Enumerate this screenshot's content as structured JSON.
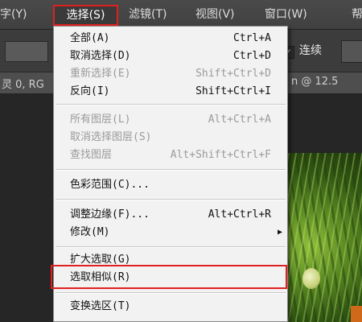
{
  "menubar": {
    "type": "字(Y)",
    "select": "选择(S)",
    "filter": "滤镜(T)",
    "view": "视图(V)",
    "window": "窗口(W)",
    "help": "帮"
  },
  "options_bar": {
    "contiguous_label": "连续",
    "contiguous_checked": true
  },
  "doc_tab": {
    "left_text": "灵 0, RG",
    "right_text": "n @ 12.5"
  },
  "select_menu": {
    "items": [
      {
        "label": "全部(A)",
        "shortcut": "Ctrl+A",
        "enabled": true
      },
      {
        "label": "取消选择(D)",
        "shortcut": "Ctrl+D",
        "enabled": true
      },
      {
        "label": "重新选择(E)",
        "shortcut": "Shift+Ctrl+D",
        "enabled": false
      },
      {
        "label": "反向(I)",
        "shortcut": "Shift+Ctrl+I",
        "enabled": true
      },
      {
        "label": "所有图层(L)",
        "shortcut": "Alt+Ctrl+A",
        "enabled": false
      },
      {
        "label": "取消选择图层(S)",
        "shortcut": "",
        "enabled": false
      },
      {
        "label": "查找图层",
        "shortcut": "Alt+Shift+Ctrl+F",
        "enabled": false
      },
      {
        "label": "色彩范围(C)...",
        "shortcut": "",
        "enabled": true
      },
      {
        "label": "调整边缘(F)...",
        "shortcut": "Alt+Ctrl+R",
        "enabled": true
      },
      {
        "label": "修改(M)",
        "shortcut": "",
        "enabled": true,
        "submenu": true
      },
      {
        "label": "扩大选取(G)",
        "shortcut": "",
        "enabled": true
      },
      {
        "label": "选取相似(R)",
        "shortcut": "",
        "enabled": true,
        "highlighted": true
      },
      {
        "label": "变换选区(T)",
        "shortcut": "",
        "enabled": true
      }
    ]
  },
  "colors": {
    "highlight_red": "#e02020",
    "menu_bg": "#f2f2f2",
    "app_bg": "#2b2b2b"
  }
}
